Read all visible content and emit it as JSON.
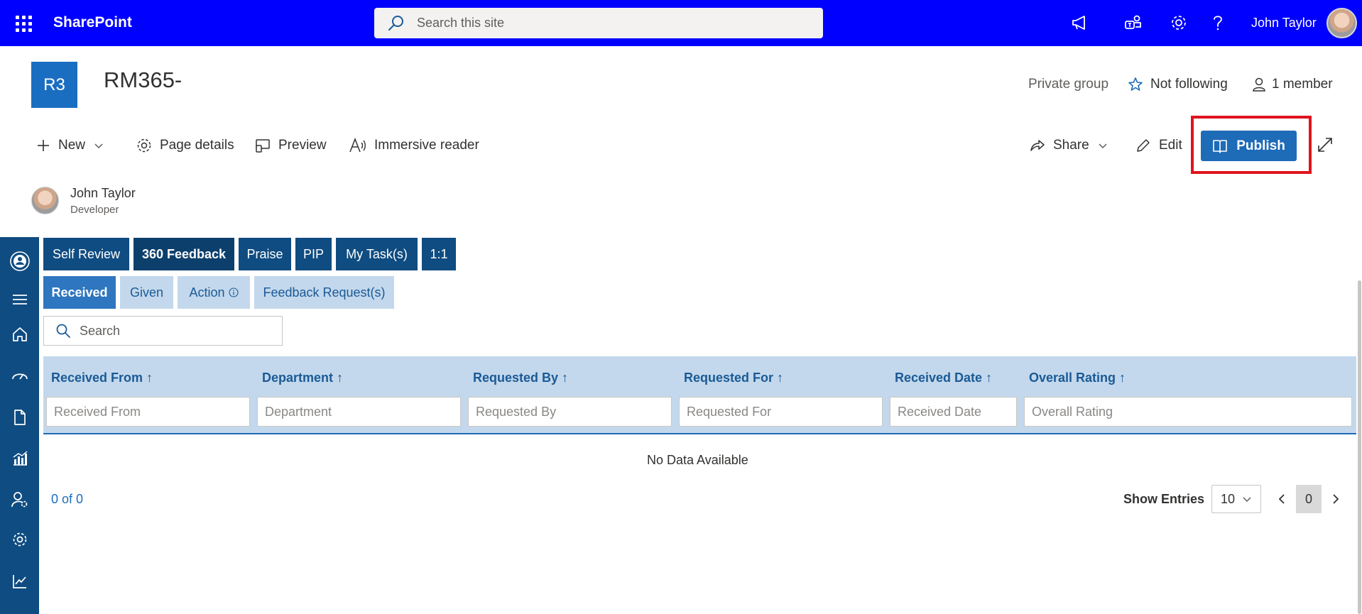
{
  "suitebar": {
    "brand": "SharePoint",
    "search_placeholder": "Search this site",
    "user_name": "John Taylor",
    "icons": [
      "megaphone-icon",
      "teams-icon",
      "gear-icon",
      "help-icon"
    ]
  },
  "site": {
    "logo_text": "R3",
    "title": "RM365-",
    "privacy": "Private group",
    "follow_label": "Not following",
    "members_label": "1 member"
  },
  "commandbar": {
    "new_label": "New",
    "page_details_label": "Page details",
    "preview_label": "Preview",
    "immersive_reader_label": "Immersive reader",
    "share_label": "Share",
    "edit_label": "Edit",
    "publish_label": "Publish"
  },
  "author": {
    "name": "John Taylor",
    "role": "Developer"
  },
  "tabs_primary": [
    {
      "label": "Self Review",
      "active": false
    },
    {
      "label": "360 Feedback",
      "active": true
    },
    {
      "label": "Praise",
      "active": false
    },
    {
      "label": "PIP",
      "active": false
    },
    {
      "label": "My Task(s)",
      "active": false
    },
    {
      "label": "1:1",
      "active": false
    }
  ],
  "tabs_secondary": [
    {
      "label": "Received",
      "active": true
    },
    {
      "label": "Given",
      "active": false
    },
    {
      "label": "Action",
      "active": false
    },
    {
      "label": "Feedback Request(s)",
      "active": false
    }
  ],
  "grid": {
    "search_placeholder": "Search",
    "columns": [
      {
        "header": "Received From ↑",
        "filter_placeholder": "Received From"
      },
      {
        "header": "Department ↑",
        "filter_placeholder": "Department"
      },
      {
        "header": "Requested By ↑",
        "filter_placeholder": "Requested By"
      },
      {
        "header": "Requested For ↑",
        "filter_placeholder": "Requested For"
      },
      {
        "header": "Received Date ↑",
        "filter_placeholder": "Received Date"
      },
      {
        "header": "Overall Rating ↑",
        "filter_placeholder": "Overall Rating"
      }
    ],
    "empty_message": "No Data Available",
    "record_count": "0 of 0",
    "show_entries_label": "Show Entries",
    "entries_value": "10",
    "current_page": "0"
  },
  "colors": {
    "suitebar": "#0000ff",
    "rail": "#0f4c81",
    "accent": "#1e6bb8",
    "highlight": "#e0141e"
  }
}
